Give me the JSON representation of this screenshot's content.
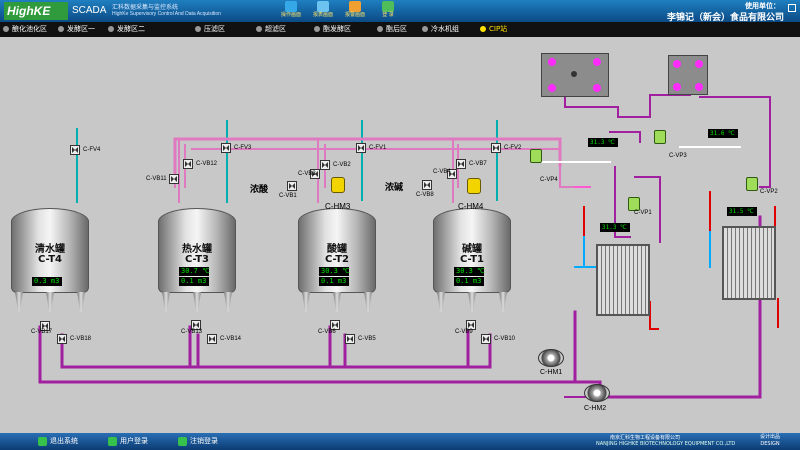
{
  "colors": {
    "pipe_magenta": "#a020a0",
    "pipe_pink": "#e07ac0",
    "pipe_red": "#e00000",
    "pipe_blue": "#00aaff",
    "pipe_teal": "#00b0b0",
    "lcd_green": "#00e000",
    "active_nav": "#ffe100"
  },
  "header": {
    "logo": "HighKE",
    "scada": "SCADA",
    "system_cn": "汇科数据采集与监控系统",
    "system_en": "HighKe Supervisory Control And Data Acquisition",
    "buttons": [
      {
        "icon": "process-flow-icon",
        "label": "操作画面"
      },
      {
        "icon": "data-report-icon",
        "label": "报表画面"
      },
      {
        "icon": "alarm-icon",
        "label": "报警画面"
      },
      {
        "icon": "login-icon",
        "label": "登 录"
      }
    ],
    "user_label": "使用单位：",
    "user_company": "李锦记（新会）食品有限公司"
  },
  "nav": {
    "items": [
      {
        "label": "酿化池化区",
        "active": false
      },
      {
        "label": "发酵区一",
        "active": false
      },
      {
        "label": "发酵区二",
        "active": false
      },
      {
        "label": "压滤区",
        "active": false
      },
      {
        "label": "超滤区",
        "active": false
      },
      {
        "label": "酯发酵区",
        "active": false
      },
      {
        "label": "酯后区",
        "active": false
      },
      {
        "label": "冷水机组",
        "active": false
      },
      {
        "label": "CIP站",
        "active": true
      }
    ]
  },
  "tanks": [
    {
      "name": "清水罐",
      "code": "C-T4",
      "temp": "",
      "level": "0.3 m3"
    },
    {
      "name": "热水罐",
      "code": "C-T3",
      "temp": "30.7 ℃",
      "level": "0.1 m3"
    },
    {
      "name": "酸罐",
      "code": "C-T2",
      "temp": "30.3 ℃",
      "level": "0.1 m3"
    },
    {
      "name": "碱罐",
      "code": "C-T1",
      "temp": "30.3 ℃",
      "level": "0.1 m3"
    }
  ],
  "valves": {
    "fv4": "C-FV4",
    "fv3": "C-FV3",
    "fv1": "C-FV1",
    "fv2": "C-FV2",
    "vb11": "C-VB11",
    "vb12": "C-VB12",
    "vb3": "C-VB3",
    "vb2": "C-VB2",
    "vb1": "C-VB1",
    "vb4": "C-VB4",
    "vb7": "C-VB7",
    "vb8": "C-VB8",
    "vb17": "C-VB17",
    "vb18": "C-VB18",
    "vb13": "C-VB13",
    "vb14": "C-VB14",
    "vb6": "C-VB6",
    "vb5": "C-VB5",
    "vb9": "C-VB9",
    "vb10": "C-VB10",
    "vp4": "C-VP4",
    "vp1": "C-VP1",
    "vp3": "C-VP3",
    "vp2": "C-VP2"
  },
  "labels": {
    "acid": "浓酸",
    "alkali": "浓碱",
    "hm3": "C-HM3",
    "hm4": "C-HM4",
    "hm1": "C-HM1",
    "hm2": "C-HM2"
  },
  "temps": {
    "t_top_left": "31.3 ℃",
    "t_top_right": "31.6 ℃",
    "t_mid_left": "31.3 ℃",
    "t_mid_right": "31.5 ℃"
  },
  "footer": {
    "buttons": [
      "退出系统",
      "用户登录",
      "注销登录"
    ],
    "company_cn": "南京汇科生物工程设备有限公司",
    "company_en": "NANJING HIGHKE BIOTECHNOLOGY EQUIPMENT CO.,LTD",
    "design_1": "设计出品",
    "design_2": "DESIGN"
  }
}
